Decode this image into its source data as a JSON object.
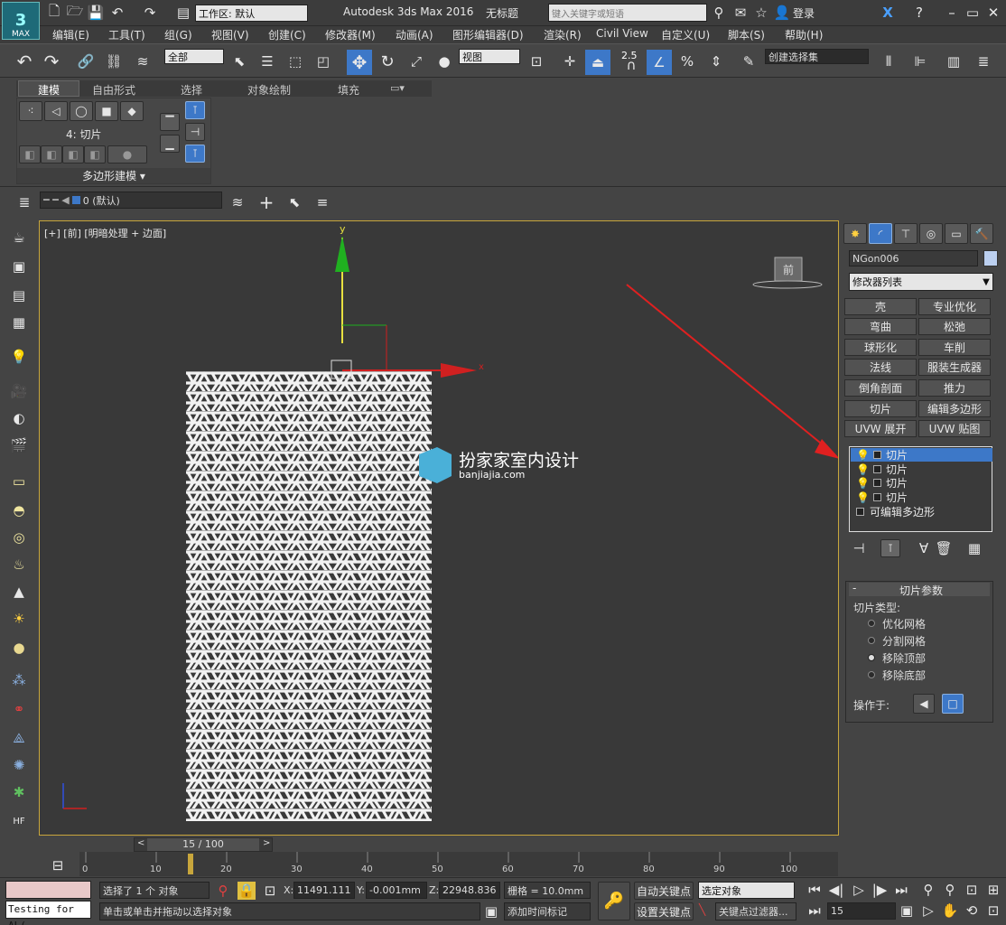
{
  "title": {
    "workspace_label": "工作区: 默认",
    "app_title": "Autodesk 3ds Max 2016",
    "doc_title": "无标题",
    "search_placeholder": "键入关键字或短语",
    "login": "登录",
    "max_logo": "MAX"
  },
  "menu": [
    "编辑(E)",
    "工具(T)",
    "组(G)",
    "视图(V)",
    "创建(C)",
    "修改器(M)",
    "动画(A)",
    "图形编辑器(D)",
    "渲染(R)",
    "Civil View",
    "自定义(U)",
    "脚本(S)",
    "帮助(H)"
  ],
  "toolbar": {
    "selection_filter": "全部",
    "ref_coord": "视图",
    "snap_value": "2.5",
    "named_selection": "创建选择集"
  },
  "ribbon": {
    "tabs": [
      "建模",
      "自由形式",
      "选择",
      "对象绘制",
      "填充"
    ],
    "sub_label": "4: 切片",
    "group_label": "多边形建模"
  },
  "layer": {
    "name": "0 (默认)"
  },
  "viewport": {
    "label": "[+] [前] [明暗处理 + 边面]",
    "axis_y": "y",
    "axis_x": "x",
    "cube_label": "前",
    "watermark_cn": "扮家家室内设计",
    "watermark_url": "banjiajia.com"
  },
  "command_panel": {
    "object_name": "NGon006",
    "modifier_list": "修改器列表",
    "modifiers": [
      "壳",
      "专业优化",
      "弯曲",
      "松弛",
      "球形化",
      "车削",
      "法线",
      "服装生成器",
      "倒角剖面",
      "推力",
      "切片",
      "编辑多边形",
      "UVW 展开",
      "UVW 贴图"
    ],
    "stack": [
      "切片",
      "切片",
      "切片",
      "切片",
      "可编辑多边形"
    ],
    "rollout_title": "切片参数",
    "slice_type_label": "切片类型:",
    "slice_options": [
      "优化网格",
      "分割网格",
      "移除顶部",
      "移除底部"
    ],
    "selected_option": "移除顶部",
    "operate_on_label": "操作于:"
  },
  "timeline": {
    "frame": "15 / 100",
    "ticks": [
      "0",
      "10",
      "20",
      "30",
      "40",
      "50",
      "60",
      "70",
      "80",
      "90",
      "100"
    ]
  },
  "status": {
    "maxscript": "Testing for AL(",
    "selected": "选择了 1 个 对象",
    "prompt": "单击或单击并拖动以选择对象",
    "x_label": "X:",
    "x_value": "11491.111",
    "y_label": "Y:",
    "y_value": "-0.001mm",
    "z_label": "Z:",
    "z_value": "22948.836",
    "grid": "栅格 = 10.0mm",
    "add_time_tag": "添加时间标记",
    "auto_key": "自动关键点",
    "set_key": "设置关键点",
    "selected_obj": "选定对象",
    "key_filters": "关键点过滤器...",
    "frame_input": "15"
  },
  "colors": {
    "accent": "#3d78c8",
    "viewport_border": "#c8a63c",
    "x_axis": "#d02020",
    "y_axis": "#20b020"
  }
}
